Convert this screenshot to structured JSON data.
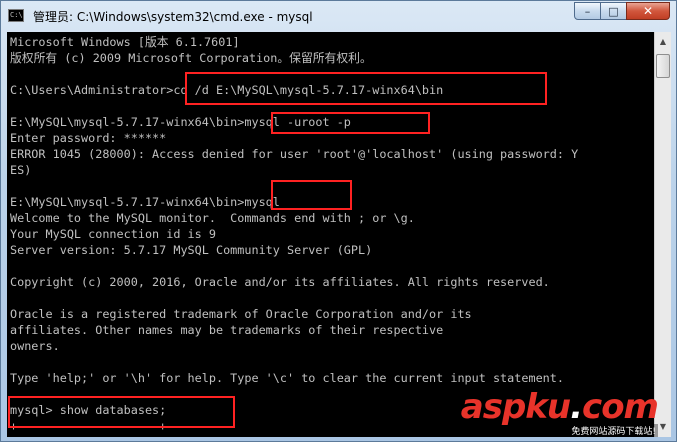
{
  "window": {
    "title": "管理员: C:\\Windows\\system32\\cmd.exe - mysql",
    "icon_text": "C:\\",
    "controls": {
      "minimize_glyph": "–",
      "maximize_glyph": "□",
      "close_glyph": "✕"
    }
  },
  "console": {
    "lines": [
      "Microsoft Windows [版本 6.1.7601]",
      "版权所有 (c) 2009 Microsoft Corporation。保留所有权利。",
      "",
      "C:\\Users\\Administrator>cd /d E:\\MySQL\\mysql-5.7.17-winx64\\bin",
      "",
      "E:\\MySQL\\mysql-5.7.17-winx64\\bin>mysql -uroot -p",
      "Enter password: ******",
      "ERROR 1045 (28000): Access denied for user 'root'@'localhost' (using password: Y",
      "ES)",
      "",
      "E:\\MySQL\\mysql-5.7.17-winx64\\bin>mysql",
      "Welcome to the MySQL monitor.  Commands end with ; or \\g.",
      "Your MySQL connection id is 9",
      "Server version: 5.7.17 MySQL Community Server (GPL)",
      "",
      "Copyright (c) 2000, 2016, Oracle and/or its affiliates. All rights reserved.",
      "",
      "Oracle is a registered trademark of Oracle Corporation and/or its",
      "affiliates. Other names may be trademarks of their respective",
      "owners.",
      "",
      "Type 'help;' or '\\h' for help. Type '\\c' to clear the current input statement.",
      "",
      "mysql> show databases;",
      "+--------------------+"
    ]
  },
  "scrollbar": {
    "up_glyph": "▲",
    "down_glyph": "▼"
  },
  "watermark": {
    "logo": "aspku",
    "logo_dot": ".",
    "logo_tld": "com",
    "tagline": "免费网站源码下载站!"
  },
  "colors": {
    "console_bg": "#000000",
    "console_fg": "#c0c0c0",
    "highlight": "#ff2222",
    "watermark": "#e8332a"
  }
}
